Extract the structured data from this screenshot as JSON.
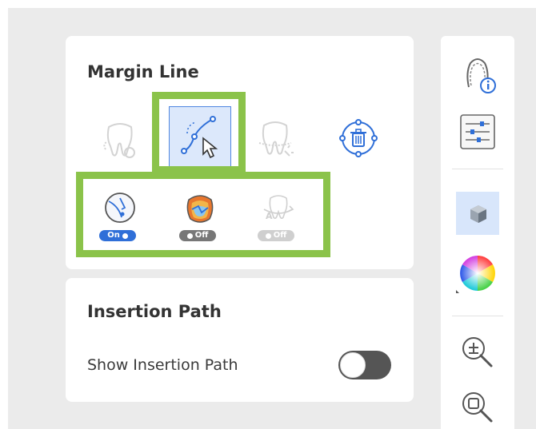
{
  "margin_line": {
    "title": "Margin Line",
    "tools": [
      {
        "icon": "tooth-draw-icon",
        "state": "disabled"
      },
      {
        "icon": "curve-select-icon",
        "state": "active"
      },
      {
        "icon": "tooth-auto-icon",
        "state": "disabled"
      },
      {
        "icon": "trash-icon",
        "state": "enabled"
      }
    ],
    "toggles": [
      {
        "icon": "margin-detect-icon",
        "label": "On",
        "state": "on"
      },
      {
        "icon": "tooth-color-map-icon",
        "label": "Off",
        "state": "off"
      },
      {
        "icon": "tooth-rotate-icon",
        "label": "Off",
        "state": "disabled"
      }
    ]
  },
  "insertion_path": {
    "title": "Insertion Path",
    "show_label": "Show Insertion Path",
    "show_value": "off"
  },
  "toolbar": {
    "items": [
      {
        "icon": "dental-arch-info-icon"
      },
      {
        "icon": "sliders-icon"
      },
      {
        "icon": "cube-view-icon"
      },
      {
        "icon": "color-wheel-icon"
      },
      {
        "icon": "zoom-in-icon"
      },
      {
        "icon": "zoom-fit-icon"
      }
    ]
  },
  "colors": {
    "highlight": "#8bc34a",
    "accent": "#2f6fd8",
    "panel_bg": "#ffffff",
    "app_bg": "#ebebeb"
  }
}
